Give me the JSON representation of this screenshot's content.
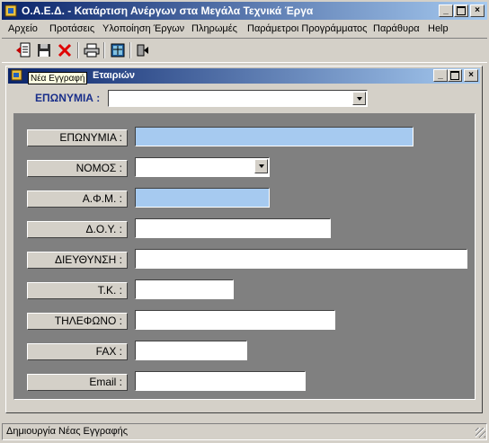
{
  "app": {
    "title": "Ο.Α.Ε.Δ. - Κατάρτιση Ανέργων στα Μεγάλα Τεχνικά Έργα"
  },
  "menu": [
    "Αρχείο",
    "Προτάσεις",
    "Υλοποίηση Έργων",
    "Πληρωμές",
    "Παράμετροι Προγράμματος",
    "Παράθυρα",
    "Help"
  ],
  "toolbar": {
    "new_icon": "new-record-icon",
    "save_icon": "save-icon",
    "delete_icon": "delete-icon",
    "print_icon": "print-icon",
    "grid_icon": "table-icon",
    "exit_icon": "exit-icon"
  },
  "child": {
    "title": "Εταιριών",
    "tooltip": "Νέα Εγγραφή",
    "search_label": "ΕΠΩΝΥΜΙΑ :",
    "search_value": ""
  },
  "form": {
    "fields": [
      {
        "label": "ΕΠΩΝΥΜΙΑ :",
        "value": ""
      },
      {
        "label": "ΝΟΜΟΣ :",
        "value": ""
      },
      {
        "label": "Α.Φ.Μ. :",
        "value": ""
      },
      {
        "label": "Δ.Ο.Υ. :",
        "value": ""
      },
      {
        "label": "ΔΙΕΥΘΥΝΣΗ :",
        "value": ""
      },
      {
        "label": "Τ.Κ. :",
        "value": ""
      },
      {
        "label": "ΤΗΛΕΦΩΝΟ :",
        "value": ""
      },
      {
        "label": "FAX :",
        "value": ""
      },
      {
        "label": "Email :",
        "value": ""
      }
    ]
  },
  "status": {
    "text": "Δημιουργία Νέας Εγγραφής"
  },
  "colors": {
    "title": "#0a246a",
    "panel": "#808080",
    "highlight": "#a6caf0",
    "label_blue": "#1a2f8a"
  }
}
